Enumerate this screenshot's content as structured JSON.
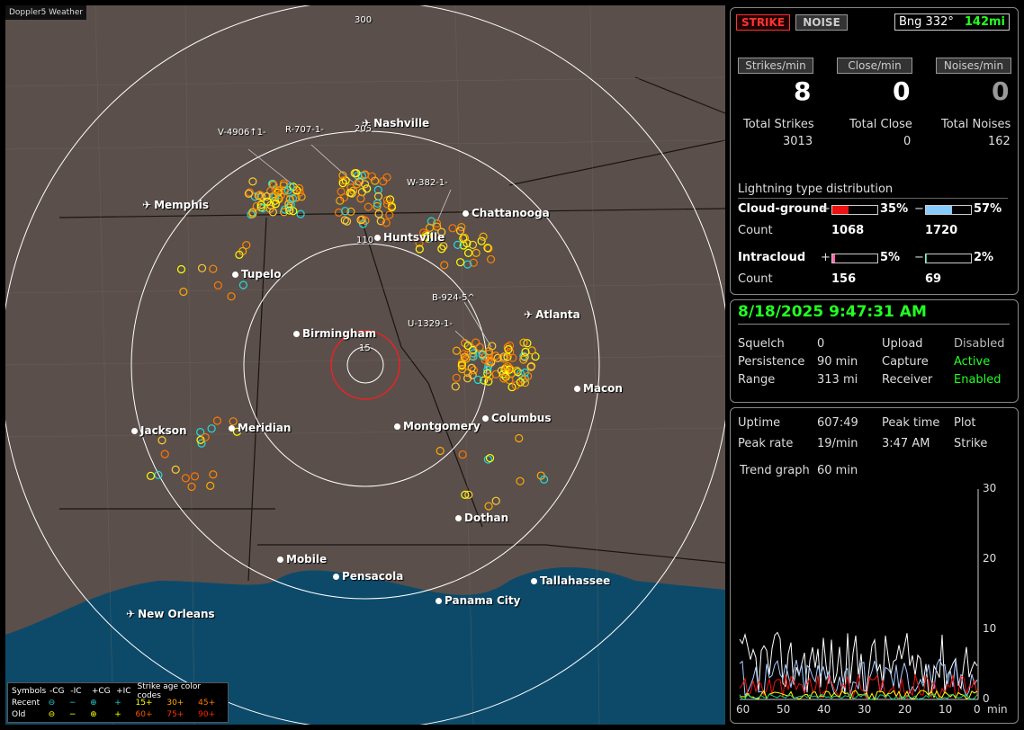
{
  "app": {
    "brand": "Doppler5 Weather"
  },
  "map": {
    "cities": [
      {
        "name": "Nashville",
        "icon": "airport"
      },
      {
        "name": "Memphis",
        "icon": "airport"
      },
      {
        "name": "Chattanooga",
        "icon": "city"
      },
      {
        "name": "Huntsville",
        "icon": "city"
      },
      {
        "name": "Tupelo",
        "icon": "city"
      },
      {
        "name": "Atlanta",
        "icon": "airport"
      },
      {
        "name": "Birmingham",
        "icon": "city"
      },
      {
        "name": "Macon",
        "icon": "city"
      },
      {
        "name": "Jackson",
        "icon": "city"
      },
      {
        "name": "Meridian",
        "icon": "city"
      },
      {
        "name": "Montgomery",
        "icon": "city"
      },
      {
        "name": "Columbus",
        "icon": "city"
      },
      {
        "name": "Dothan",
        "icon": "city"
      },
      {
        "name": "Mobile",
        "icon": "city"
      },
      {
        "name": "Pensacola",
        "icon": "city"
      },
      {
        "name": "Tallahassee",
        "icon": "city"
      },
      {
        "name": "Panama City",
        "icon": "city"
      },
      {
        "name": "New Orleans",
        "icon": "airport"
      }
    ],
    "ring_labels": [
      "300",
      "205",
      "110",
      "15"
    ],
    "storm_labels": [
      "V-4906↑1-",
      "R-707-1-",
      "W-382-1-",
      "B-924-5^",
      "U-1329-1-"
    ],
    "legend": {
      "header": [
        "Symbols",
        "-CG",
        "-IC",
        "+CG",
        "+IC",
        "Strike age color codes"
      ],
      "recent": [
        "Recent",
        "⊖",
        "−",
        "⊕",
        "+",
        "15+",
        "30+",
        "45+"
      ],
      "old": [
        "Old",
        "⊖",
        "−",
        "⊕",
        "+",
        "60+",
        "75+",
        "90+"
      ]
    }
  },
  "top": {
    "strike": "STRIKE",
    "noise": "NOISE",
    "bearing": "Bng 332°",
    "distance": "142mi"
  },
  "rates": {
    "strikes_label": "Strikes/min",
    "close_label": "Close/min",
    "noises_label": "Noises/min",
    "strikes": "8",
    "close": "0",
    "noises": "0"
  },
  "totals": {
    "strikes_label": "Total Strikes",
    "close_label": "Total Close",
    "noises_label": "Total Noises",
    "strikes": "3013",
    "close": "0",
    "noises": "162"
  },
  "dist": {
    "title": "Lightning type distribution",
    "cg_label": "Cloud-ground",
    "ic_label": "Intracloud",
    "count_label": "Count",
    "cg_pos_pct": "35%",
    "cg_neg_pct": "57%",
    "cg_pos_count": "1068",
    "cg_neg_count": "1720",
    "ic_pos_pct": "5%",
    "ic_neg_pct": "2%",
    "ic_pos_count": "156",
    "ic_neg_count": "69",
    "cg_pos_frac": 0.35,
    "cg_neg_frac": 0.57,
    "ic_pos_frac": 0.05,
    "ic_neg_frac": 0.02
  },
  "status": {
    "datetime": "8/18/2025 9:47:31 AM",
    "squelch_label": "Squelch",
    "squelch": "0",
    "persistence_label": "Persistence",
    "persistence": "90 min",
    "range_label": "Range",
    "range": "313 mi",
    "upload_label": "Upload",
    "upload": "Disabled",
    "capture_label": "Capture",
    "capture": "Active",
    "receiver_label": "Receiver",
    "receiver": "Enabled"
  },
  "trend": {
    "uptime_label": "Uptime",
    "uptime": "607:49",
    "peaktime_label": "Peak time",
    "peaktime": "3:47 AM",
    "plot_label": "Plot",
    "plot": "Strike",
    "peakrate_label": "Peak rate",
    "peakrate": "19/min",
    "graph_label": "Trend graph",
    "graph": "60 min",
    "y_ticks": [
      "30",
      "20",
      "10",
      "0"
    ],
    "x_ticks": [
      "60",
      "50",
      "40",
      "30",
      "20",
      "10",
      "0"
    ],
    "x_unit": "min"
  },
  "colors": {
    "accent_green": "#22ff22",
    "strike_red": "#ff3333",
    "bar_red": "#ee1111",
    "bar_blue": "#88ccff",
    "bar_pink": "#ff66aa",
    "bar_green": "#22cc88"
  }
}
